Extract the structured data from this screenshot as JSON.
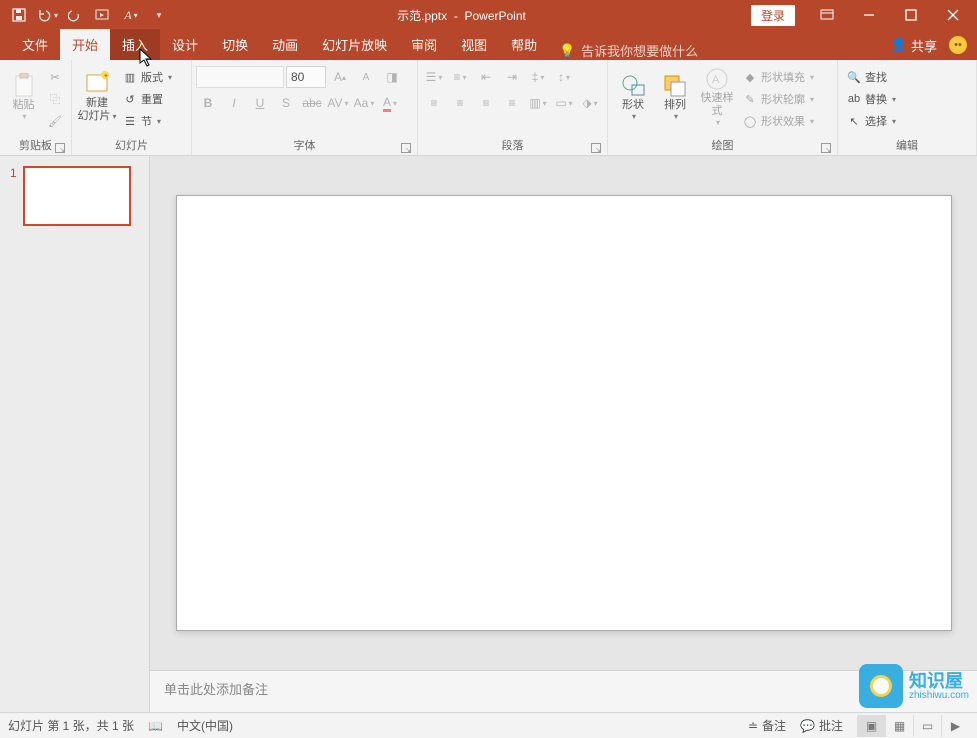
{
  "title": {
    "filename": "示范.pptx",
    "app": "PowerPoint",
    "sep": "-"
  },
  "titlebar": {
    "login": "登录"
  },
  "tabs": {
    "file": "文件",
    "home": "开始",
    "insert": "插入",
    "design": "设计",
    "transitions": "切换",
    "animations": "动画",
    "slideshow": "幻灯片放映",
    "review": "审阅",
    "view": "视图",
    "help": "帮助",
    "tellme": "告诉我你想要做什么",
    "share": "共享"
  },
  "ribbon": {
    "clipboard": {
      "label": "剪贴板",
      "paste": "粘贴"
    },
    "slides": {
      "label": "幻灯片",
      "new": "新建",
      "new2": "幻灯片",
      "layout": "版式",
      "reset": "重置",
      "section": "节"
    },
    "font": {
      "label": "字体",
      "size": "80"
    },
    "paragraph": {
      "label": "段落"
    },
    "drawing": {
      "label": "绘图",
      "shapes": "形状",
      "arrange": "排列",
      "quick": "快速样式",
      "fill": "形状填充",
      "outline": "形状轮廓",
      "effects": "形状效果"
    },
    "editing": {
      "label": "编辑",
      "find": "查找",
      "replace": "替换",
      "select": "选择"
    }
  },
  "thumbs": {
    "num1": "1"
  },
  "notes": {
    "placeholder": "单击此处添加备注"
  },
  "status": {
    "slideinfo": "幻灯片 第 1 张，共 1 张",
    "lang": "中文(中国)",
    "notes_btn": "备注",
    "comments_btn": "批注"
  },
  "watermark": {
    "name": "知识屋",
    "url": "zhishiwu.com"
  }
}
